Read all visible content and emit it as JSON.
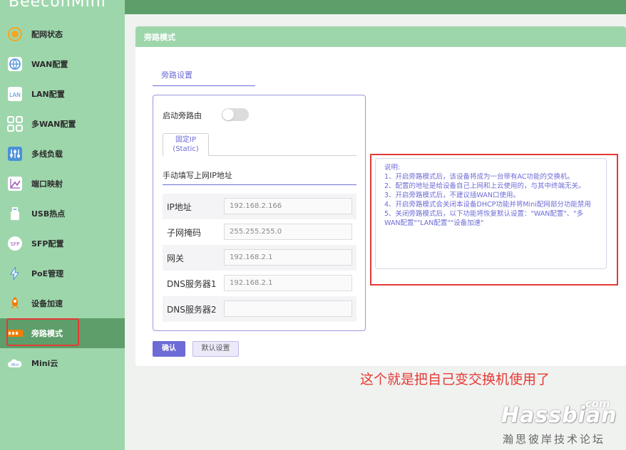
{
  "sidebar": {
    "brand": "BeeconMini",
    "items": [
      {
        "label": "配网状态",
        "icon": "network-status-icon",
        "color": "#f5a623"
      },
      {
        "label": "WAN配置",
        "icon": "globe-icon",
        "color": "#4a90d9"
      },
      {
        "label": "LAN配置",
        "icon": "lan-icon",
        "color": "#4a90d9"
      },
      {
        "label": "多WAN配置",
        "icon": "multi-wan-icon",
        "color": "#4a90d9"
      },
      {
        "label": "多线负载",
        "icon": "sliders-icon",
        "color": "#4a90d9"
      },
      {
        "label": "端口映射",
        "icon": "port-map-icon",
        "color": "#9b59b6"
      },
      {
        "label": "USB热点",
        "icon": "usb-icon",
        "color": "#4a90d9"
      },
      {
        "label": "SFP配置",
        "icon": "sfp-icon",
        "color": "#9b59b6"
      },
      {
        "label": "PoE管理",
        "icon": "poe-bolt-icon",
        "color": "#4a90d9"
      },
      {
        "label": "设备加速",
        "icon": "rocket-icon",
        "color": "#f57c00"
      },
      {
        "label": "旁路模式",
        "icon": "bypass-icon",
        "color": "#f57c00"
      },
      {
        "label": "Mini云",
        "icon": "cloud-icon",
        "color": "#4a90d9"
      }
    ],
    "active_index": 10
  },
  "card": {
    "title": "旁路模式",
    "section_tab": "旁路设置"
  },
  "form": {
    "enable_label": "启动旁路由",
    "enabled": false,
    "ip_tab_line1": "固定IP",
    "ip_tab_line2": "(Static)",
    "manual_title": "手动填写上网IP地址",
    "fields": [
      {
        "label": "IP地址",
        "value": "192.168.2.166"
      },
      {
        "label": "子网掩码",
        "value": "255.255.255.0"
      },
      {
        "label": "网关",
        "value": "192.168.2.1"
      },
      {
        "label": "DNS服务器1",
        "value": "192.168.2.1"
      },
      {
        "label": "DNS服务器2",
        "value": ""
      }
    ],
    "confirm_label": "确认",
    "reset_label": "默认设置"
  },
  "notes": {
    "heading": "说明:",
    "lines": [
      "1、开启旁路模式后，该设备将成为一台带有AC功能的交换机。",
      "2、配置的地址是给设备自己上网和上云使用的，与其中终端无关。",
      "3、开启旁路模式后，不建议插WAN口使用。",
      "4、开启旁路模式会关闭本设备DHCP功能并将Mini配网部分功能禁用",
      "5、关闭旁路模式后，以下功能将恢复默认设置：\"WAN配置\"、\"多WAN配置\"\"LAN配置\"\"设备加速\""
    ]
  },
  "annotation": {
    "caption": "这个就是把自己变交换机使用了"
  },
  "watermark": {
    "com": ".com",
    "main": "Hassbian",
    "sub": "瀚思彼岸技术论坛"
  },
  "colors": {
    "sidebar_bg": "#9ed6ac",
    "active_bg": "#5e9e6a",
    "accent": "#6d6bd6",
    "highlight_red": "#e53935"
  }
}
